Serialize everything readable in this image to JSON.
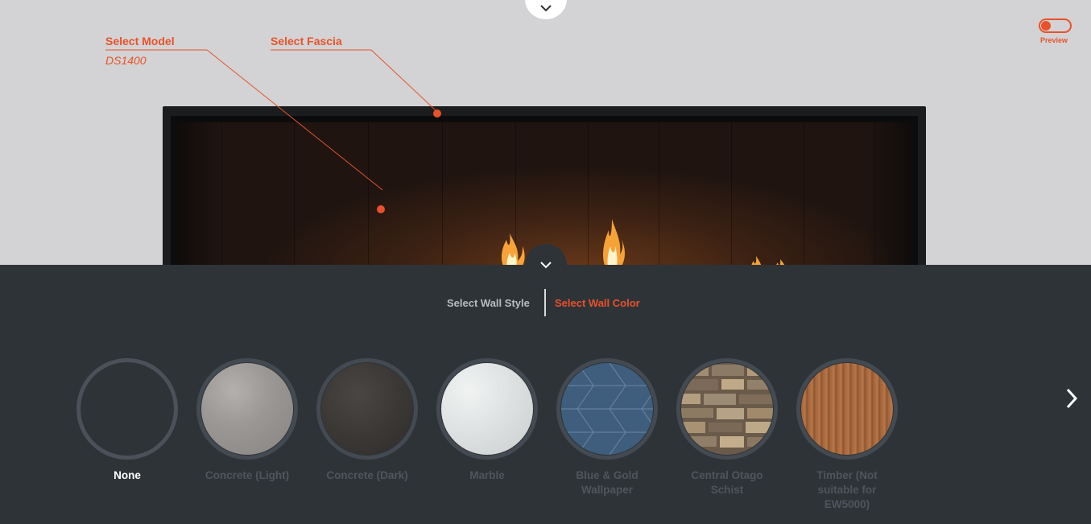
{
  "model": {
    "label": "Select Model",
    "value": "DS1400"
  },
  "fascia": {
    "label": "Select Fascia"
  },
  "preview": {
    "label": "Preview",
    "enabled": false
  },
  "tabs": [
    {
      "label": "Select Wall Style",
      "active": false
    },
    {
      "label": "Select Wall Color",
      "active": true
    }
  ],
  "swatches": [
    {
      "name": "None",
      "selected": true
    },
    {
      "name": "Concrete (Light)",
      "selected": false
    },
    {
      "name": "Concrete (Dark)",
      "selected": false
    },
    {
      "name": "Marble",
      "selected": false
    },
    {
      "name": "Blue & Gold Wallpaper",
      "selected": false
    },
    {
      "name": "Central Otago Schist",
      "selected": false
    },
    {
      "name": "Timber (Not suitable for EW5000)",
      "selected": false
    }
  ],
  "colors": {
    "accent": "#e8522a",
    "panel_bg": "#2e3338",
    "stage_bg": "#d3d3d5"
  },
  "icons": {
    "top_toggle": "chevron-down-icon",
    "mid_toggle": "chevron-down-icon",
    "next": "chevron-right-icon"
  }
}
